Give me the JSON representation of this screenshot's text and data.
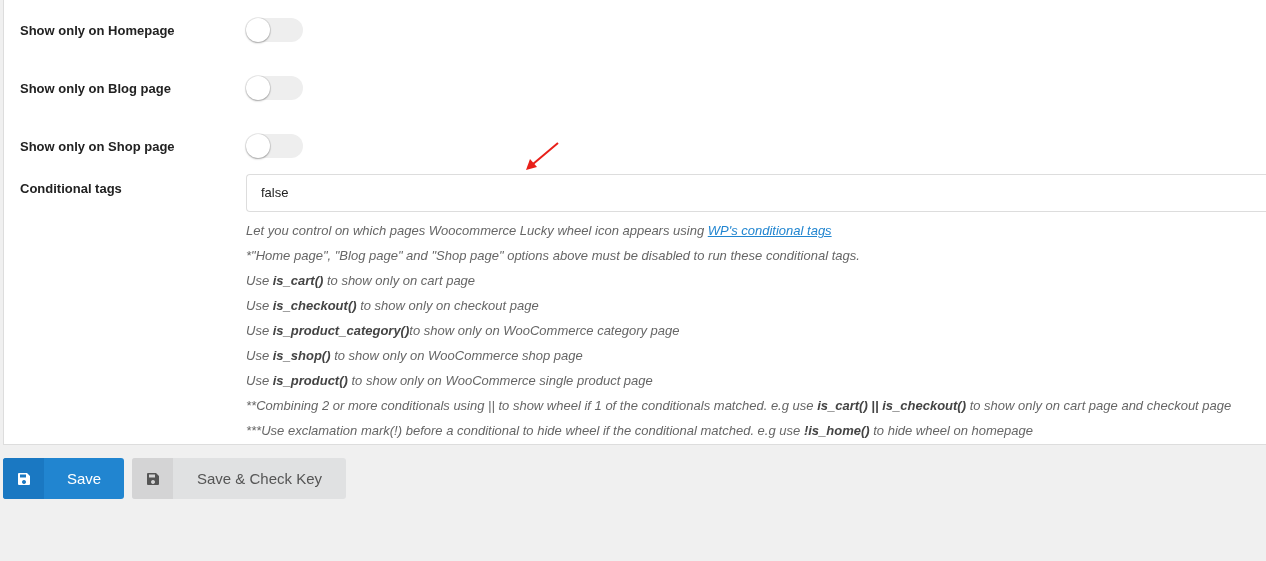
{
  "settings": [
    {
      "label": "Show only on Homepage",
      "kind": "toggle",
      "on": false
    },
    {
      "label": "Show only on Blog page",
      "kind": "toggle",
      "on": false
    },
    {
      "label": "Show only on Shop page",
      "kind": "toggle",
      "on": false
    },
    {
      "label": "Conditional tags",
      "kind": "text",
      "value": "false"
    }
  ],
  "help": [
    {
      "text": "Let you control on which pages Woocommerce Lucky wheel icon appears using ",
      "link": "WP's conditional tags"
    },
    {
      "prefix": "*",
      "text": "\"Home page\", \"Blog page\" and \"Shop page\" options above must be disabled to run these conditional tags."
    },
    {
      "text": "Use **is_cart()** to show only on cart page"
    },
    {
      "text": "Use **is_checkout()** to show only on checkout page"
    },
    {
      "text": "Use **is_product_category()**to show only on WooCommerce category page"
    },
    {
      "text": "Use **is_shop()** to show only on WooCommerce shop page"
    },
    {
      "text": "Use **is_product()** to show only on WooCommerce single product page"
    },
    {
      "prefix": "**",
      "text": "Combining 2 or more conditionals using || to show wheel if 1 of the conditionals matched. e.g use **is_cart() || is_checkout()** to show only on cart page and checkout page"
    },
    {
      "prefix": "***",
      "text": "Use exclamation mark(!) before a conditional to hide wheel if the conditional matched. e.g use **!is_home()** to hide wheel on homepage"
    }
  ],
  "buttons": [
    {
      "label": "Save",
      "kind": "primary"
    },
    {
      "label": "Save & Check Key",
      "kind": "secondary"
    }
  ]
}
